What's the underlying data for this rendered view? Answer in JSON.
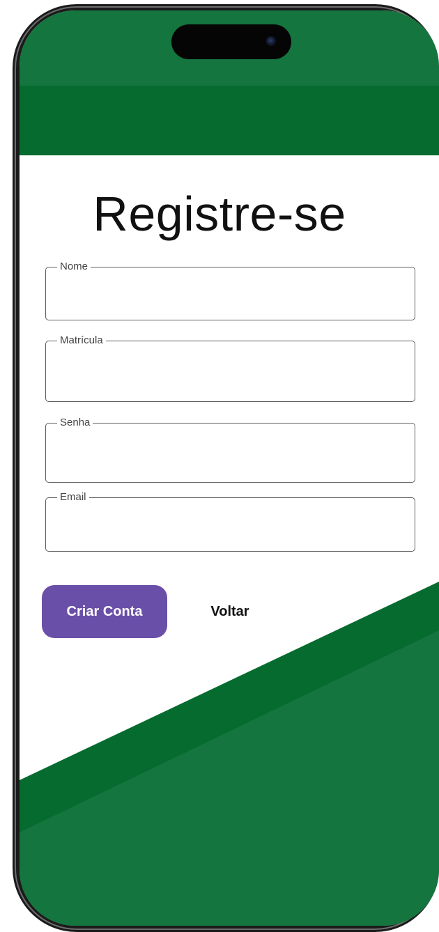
{
  "colors": {
    "primary_green": "#14753e",
    "dark_green": "#066b2f",
    "button_purple": "#6a4fa8",
    "background": "#ffffff",
    "text": "#111111"
  },
  "page": {
    "title": "Registre-se"
  },
  "form": {
    "fields": [
      {
        "label": "Nome",
        "value": ""
      },
      {
        "label": "Matrícula",
        "value": ""
      },
      {
        "label": "Senha",
        "value": ""
      },
      {
        "label": "Email",
        "value": ""
      }
    ]
  },
  "actions": {
    "create_account_label": "Criar Conta",
    "back_label": "Voltar"
  }
}
